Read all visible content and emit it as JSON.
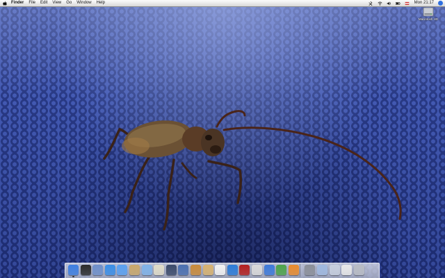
{
  "menubar": {
    "app_name": "Finder",
    "menus": [
      "File",
      "Edit",
      "View",
      "Go",
      "Window",
      "Help"
    ],
    "clock": "Mon 21:17"
  },
  "desktop": {
    "hd_label": "Macintosh HD"
  },
  "dock": {
    "items": [
      {
        "icon": "finder-icon",
        "color": "#3d7ee0"
      },
      {
        "icon": "dashboard-icon",
        "color": "#2b2b2b"
      },
      {
        "icon": "mail-icon",
        "color": "#6e8fc9"
      },
      {
        "icon": "safari-icon",
        "color": "#3a8ee6"
      },
      {
        "icon": "ichat-icon",
        "color": "#5aa0f0"
      },
      {
        "icon": "address-book-icon",
        "color": "#c9a86a"
      },
      {
        "icon": "itunes-icon",
        "color": "#7fb2e8"
      },
      {
        "icon": "iphoto-icon",
        "color": "#e0dcc8"
      },
      {
        "icon": "imovie-icon",
        "color": "#3b4a6a"
      },
      {
        "icon": "idvd-icon",
        "color": "#4a6fb0"
      },
      {
        "icon": "garageband-icon",
        "color": "#c98a3a"
      },
      {
        "icon": "iweb-icon",
        "color": "#d7b270"
      },
      {
        "icon": "ical-icon",
        "color": "#f2f2f2"
      },
      {
        "icon": "quicktime-icon",
        "color": "#2b7bd8"
      },
      {
        "icon": "photo-booth-icon",
        "color": "#b31f1f"
      },
      {
        "icon": "preview-icon",
        "color": "#d9d9d9"
      },
      {
        "icon": "keynote-icon",
        "color": "#3d79d9"
      },
      {
        "icon": "numbers-icon",
        "color": "#4da34a"
      },
      {
        "icon": "pages-icon",
        "color": "#e88a2d"
      },
      {
        "icon": "system-preferences-icon",
        "color": "#8b8f98"
      },
      {
        "icon": "applications-folder-icon",
        "color": "#9fb8df"
      },
      {
        "icon": "documents-folder-icon",
        "color": "#c6cedd"
      },
      {
        "icon": "downloads-stack-icon",
        "color": "#e8e8e8"
      },
      {
        "icon": "trash-icon",
        "color": "#b8bcc4"
      }
    ]
  }
}
